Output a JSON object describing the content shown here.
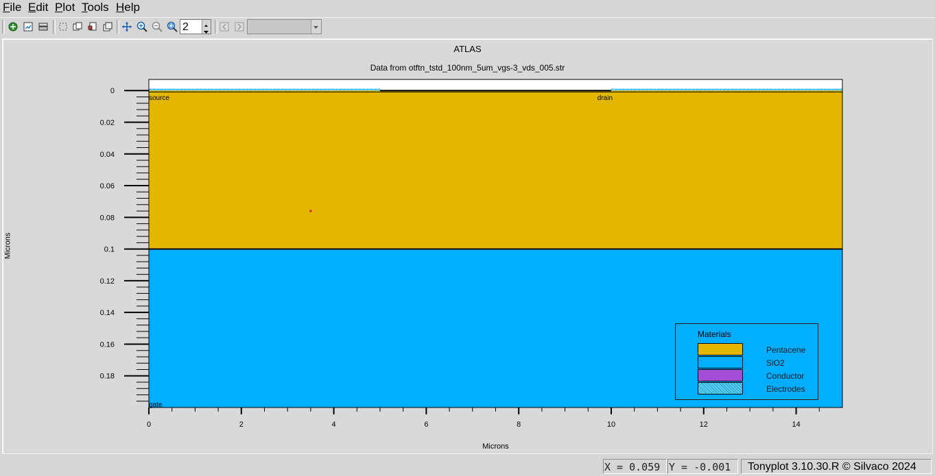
{
  "menubar": {
    "items": [
      {
        "mnemonic": "F",
        "rest": "ile"
      },
      {
        "mnemonic": "E",
        "rest": "dit"
      },
      {
        "mnemonic": "P",
        "rest": "lot"
      },
      {
        "mnemonic": "T",
        "rest": "ools"
      },
      {
        "mnemonic": "H",
        "rest": "elp"
      }
    ]
  },
  "toolbar": {
    "icons": [
      "load-icon",
      "save-icon",
      "print-icon",
      "select-icon",
      "copy-icon",
      "cut-icon",
      "paste-icon",
      "pan-icon",
      "zoom-in-icon",
      "zoom-out-icon",
      "zoom-box-icon",
      "previous-plot-icon",
      "next-plot-icon"
    ],
    "zoom_value": "2",
    "combo_value": ""
  },
  "plot": {
    "title": "ATLAS",
    "subtitle": "Data from otftn_tstd_100nm_5um_vgs-3_vds_005.str",
    "xlabel": "Microns",
    "ylabel": "Microns",
    "electrode_labels": [
      "source",
      "drain",
      "gate"
    ],
    "legend": {
      "title": "Materials",
      "entries": [
        "Pentacene",
        "SiO2",
        "Conductor",
        "Electrodes"
      ],
      "colors": [
        "#e3b600",
        "#00adff",
        "#a24fd6",
        "#5fcfef"
      ]
    }
  },
  "chart_data": {
    "type": "heatmap",
    "title": "ATLAS",
    "subtitle": "Data from otftn_tstd_100nm_5um_vgs-3_vds_005.str",
    "xlabel": "Microns",
    "ylabel": "Microns",
    "xlim": [
      0,
      15
    ],
    "ylim": [
      0.2,
      -0.007
    ],
    "x_ticks": [
      0,
      2,
      4,
      6,
      8,
      10,
      12,
      14
    ],
    "y_ticks": [
      0,
      0.02,
      0.04,
      0.06,
      0.08,
      0.1,
      0.12,
      0.14,
      0.16,
      0.18
    ],
    "x_tick_labels": [
      "0",
      "2",
      "4",
      "6",
      "8",
      "10",
      "12",
      "14"
    ],
    "y_tick_labels": [
      "0",
      "0.02",
      "0.04",
      "0.06",
      "0.08",
      "0.1",
      "0.12",
      "0.14",
      "0.16",
      "0.18"
    ],
    "regions": [
      {
        "material": "Pentacene",
        "x": [
          0,
          15
        ],
        "y": [
          0,
          0.1
        ],
        "color": "#e3b600"
      },
      {
        "material": "SiO2",
        "x": [
          0,
          15
        ],
        "y": [
          0.1,
          0.2
        ],
        "color": "#00adff"
      },
      {
        "material": "Electrodes",
        "name": "source",
        "x": [
          0,
          5
        ],
        "y": [
          -0.0012,
          0
        ],
        "color": "#5fcfef"
      },
      {
        "material": "Electrodes",
        "name": "drain",
        "x": [
          10,
          15
        ],
        "y": [
          -0.0012,
          0
        ],
        "color": "#5fcfef"
      }
    ],
    "marker": {
      "x": 3.5,
      "y": 0.076,
      "color": "#d0342c"
    },
    "legend_position": "bottom-right",
    "grid": false
  },
  "status": {
    "x_readout": "X = 0.059",
    "y_readout": "Y = -0.001",
    "version": "Tonyplot 3.10.30.R © Silvaco 2024"
  }
}
